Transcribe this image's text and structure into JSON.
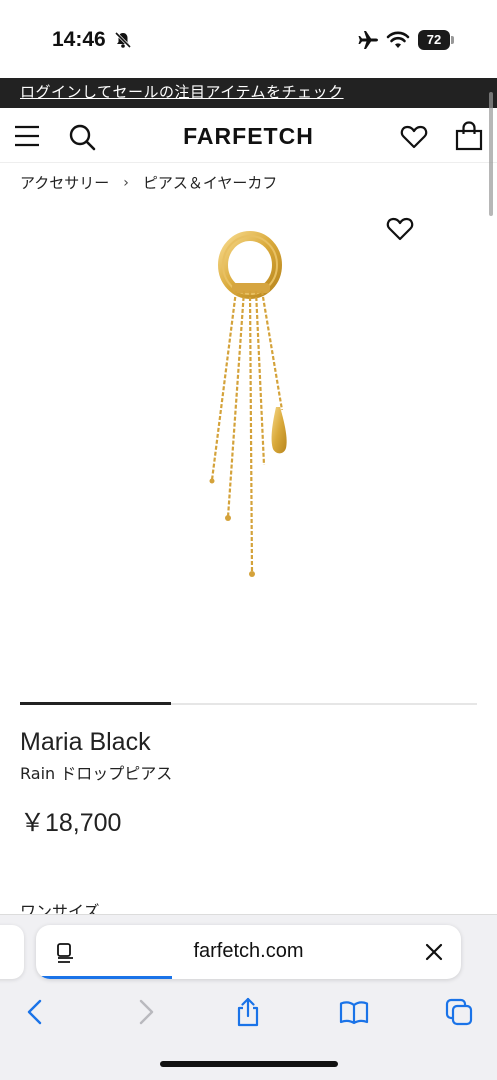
{
  "status_bar": {
    "time": "14:46",
    "battery": "72",
    "icons": [
      "bell-slash-icon",
      "airplane-icon",
      "wifi-icon",
      "battery-icon"
    ]
  },
  "promo": {
    "text": "ログインしてセールの注目アイテムをチェック"
  },
  "header": {
    "logo": "FARFETCH",
    "icons": [
      "menu-icon",
      "search-icon",
      "heart-icon",
      "bag-icon"
    ]
  },
  "breadcrumb": {
    "items": [
      "アクセサリー",
      "ピアス＆イヤーカフ"
    ],
    "separator": "›"
  },
  "gallery": {
    "progress": 0.33
  },
  "product": {
    "brand": "Maria Black",
    "name": "Rain ドロップピアス",
    "price": "￥18,700",
    "size_label": "ワンサイズ"
  },
  "browser": {
    "url": "farfetch.com",
    "load_progress": 0.32,
    "accent": "#1a73e8",
    "toolbar_icons": [
      "back-icon",
      "forward-icon",
      "share-icon",
      "bookmarks-icon",
      "tabs-icon"
    ]
  }
}
